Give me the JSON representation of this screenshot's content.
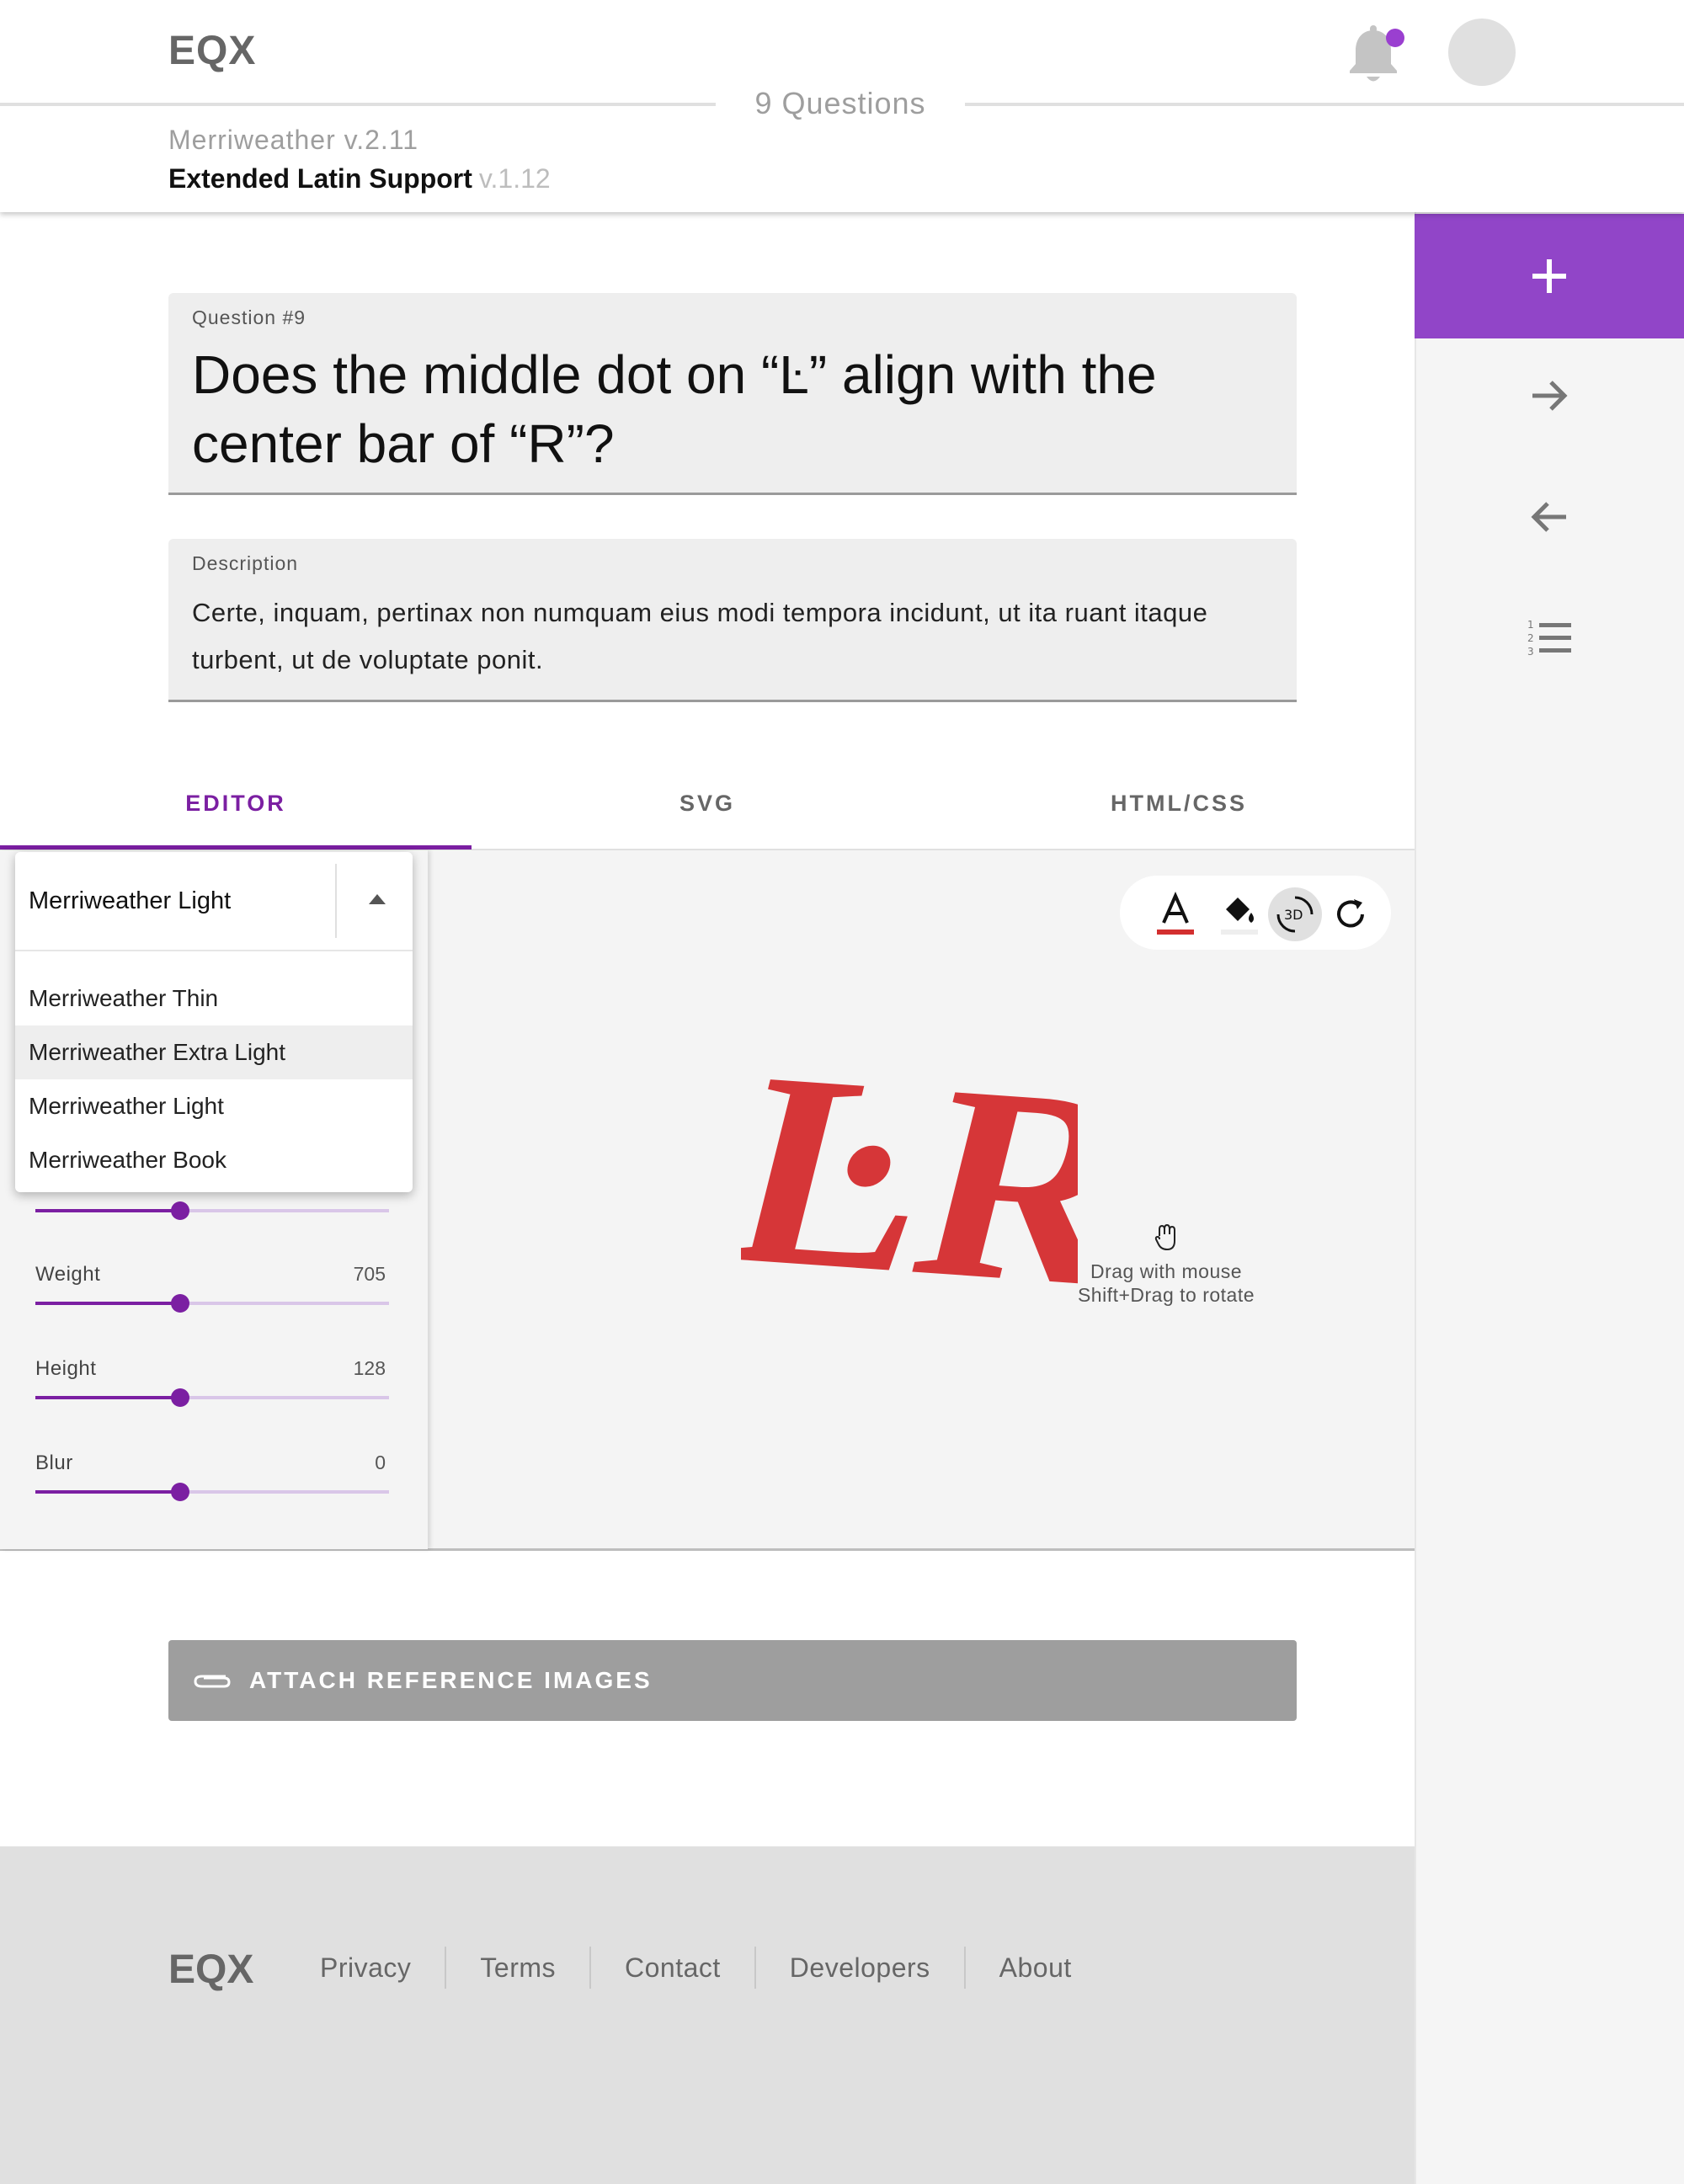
{
  "header": {
    "brand": "EQX",
    "questions_count": "9 Questions",
    "font_version": "Merriweather v.2.11",
    "subset_name": "Extended Latin Support",
    "subset_version": "v.1.12"
  },
  "question": {
    "label": "Question #9",
    "text": "Does the middle dot on “Ŀ” align with the center bar of “R”?"
  },
  "description": {
    "label": "Description",
    "text": "Certe, inquam, pertinax non numquam eius modi tempora incidunt, ut ita ruant itaque turbent, ut de voluptate ponit."
  },
  "tabs": [
    {
      "label": "EDITOR",
      "active": true
    },
    {
      "label": "SVG",
      "active": false
    },
    {
      "label": "HTML/CSS",
      "active": false
    }
  ],
  "font_select": {
    "selected": "Merriweather Light",
    "options": [
      "Merriweather Thin",
      "Merriweather Extra Light",
      "Merriweather Light",
      "Merriweather Book"
    ],
    "highlighted": "Merriweather Extra Light"
  },
  "sliders": [
    {
      "label": "",
      "value": "",
      "level": 0.41
    },
    {
      "label": "Weight",
      "value": "705",
      "level": 0.41
    },
    {
      "label": "Height",
      "value": "128",
      "level": 0.41
    },
    {
      "label": "Blur",
      "value": "0",
      "level": 0.41
    }
  ],
  "toolbar": {
    "text_color": "#d32f2f",
    "icons": [
      "text-color-icon",
      "fill-color-icon",
      "3d-rotate-icon",
      "refresh-icon"
    ],
    "rotate_badge": "3D"
  },
  "preview": {
    "glyphs": "ĿR",
    "glyph_color": "#d63638",
    "hint_line1": "Drag with mouse",
    "hint_line2": "Shift+Drag to rotate"
  },
  "attach": {
    "label": "ATTACH REFERENCE IMAGES"
  },
  "rail": {
    "accent": "#9145c8",
    "icons": [
      "add-icon",
      "arrow-forward-icon",
      "arrow-back-icon",
      "numbered-list-icon"
    ]
  },
  "footer": {
    "brand": "EQX",
    "links": [
      "Privacy",
      "Terms",
      "Contact",
      "Developers",
      "About"
    ]
  }
}
